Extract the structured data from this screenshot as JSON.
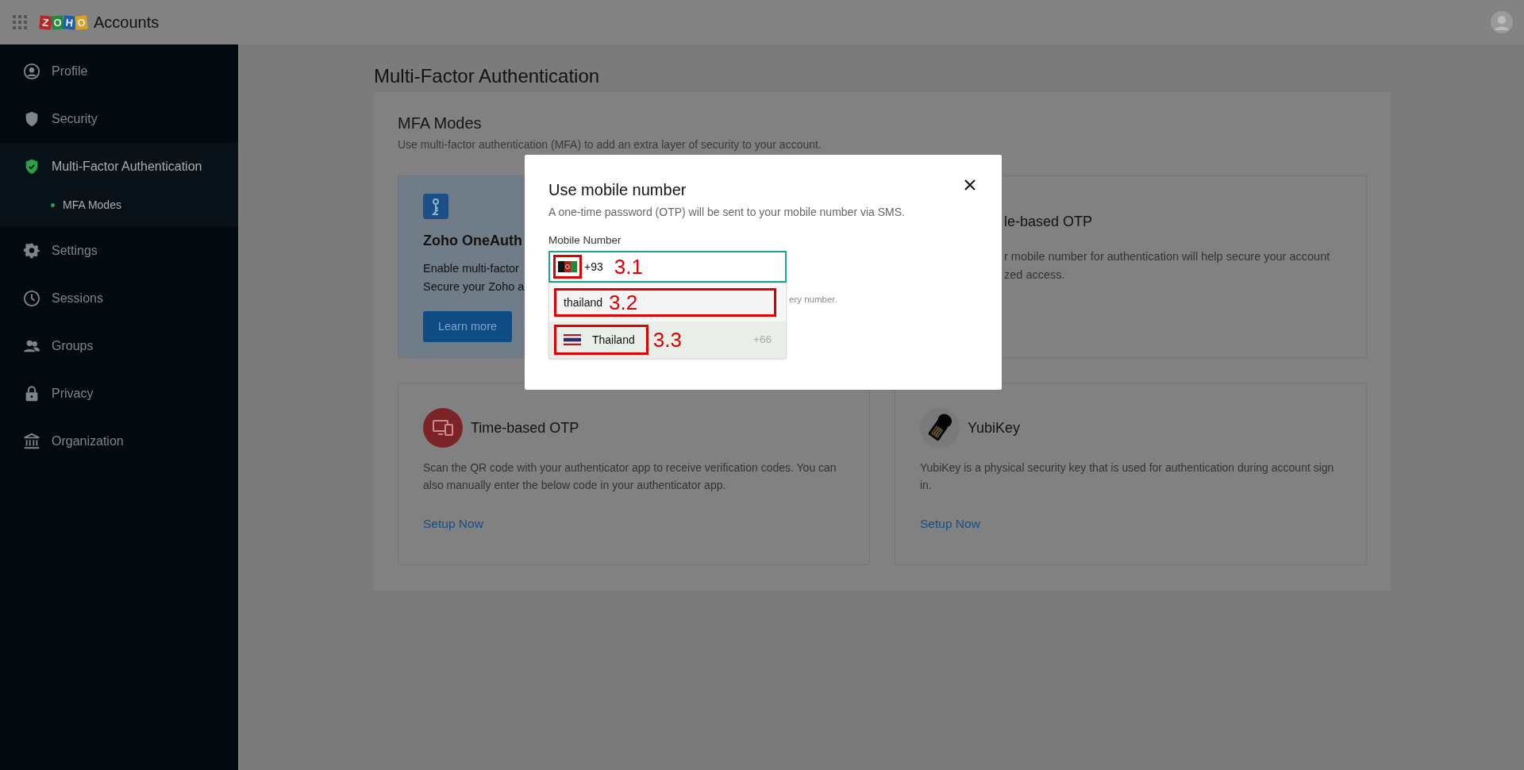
{
  "header": {
    "logo_letters": [
      {
        "text": "Z",
        "color": "#b8262b"
      },
      {
        "text": "O",
        "color": "#1f8a3a"
      },
      {
        "text": "H",
        "color": "#1b5fa8"
      },
      {
        "text": "O",
        "color": "#d9a21c"
      }
    ],
    "app_name": "Accounts"
  },
  "sidebar": {
    "items": [
      {
        "label": "Profile",
        "kind": "profile",
        "selected": false
      },
      {
        "label": "Security",
        "kind": "shield",
        "selected": false
      },
      {
        "label": "Multi-Factor Authentication",
        "kind": "mfa",
        "selected": true,
        "children": [
          {
            "label": "MFA Modes",
            "selected": true
          }
        ]
      },
      {
        "label": "Settings",
        "kind": "gear",
        "selected": false
      },
      {
        "label": "Sessions",
        "kind": "clock",
        "selected": false
      },
      {
        "label": "Groups",
        "kind": "people",
        "selected": false
      },
      {
        "label": "Privacy",
        "kind": "lock",
        "selected": false
      },
      {
        "label": "Organization",
        "kind": "building",
        "selected": false
      }
    ]
  },
  "page": {
    "title": "Multi-Factor Authentication",
    "section_title": "MFA Modes",
    "section_description": "Use multi-factor authentication (MFA) to add an extra layer of security to your account.",
    "cards": [
      {
        "kind": "oneauth",
        "title": "Zoho OneAuth",
        "lines": [
          "Enable multi-factor",
          "Secure your Zoho a"
        ],
        "button": "Learn more"
      },
      {
        "kind": "mobile",
        "title": "le-based OTP",
        "lines": [
          "r mobile number for authentication will help secure your account",
          "zed access."
        ]
      },
      {
        "kind": "totp",
        "title": "Time-based OTP",
        "description": "Scan the QR code with your authenticator app to receive verification codes. You can also manually enter the below code in your authenticator app.",
        "link": "Setup Now"
      },
      {
        "kind": "yubikey",
        "title": "YubiKey",
        "description": "YubiKey is a physical security key that is used for authentication during account sign in.",
        "link": "Setup Now"
      }
    ]
  },
  "dialog": {
    "title": "Use mobile number",
    "description": "A one-time password (OTP) will be sent to your mobile number via SMS.",
    "field_label": "Mobile Number",
    "country_code": "+93",
    "hint": "ery number.",
    "dropdown": {
      "search_value": "thailand",
      "options": [
        {
          "name": "Thailand",
          "code": "+66",
          "selected": true
        }
      ]
    },
    "annotations": [
      "3.1",
      "3.2",
      "3.3"
    ]
  }
}
